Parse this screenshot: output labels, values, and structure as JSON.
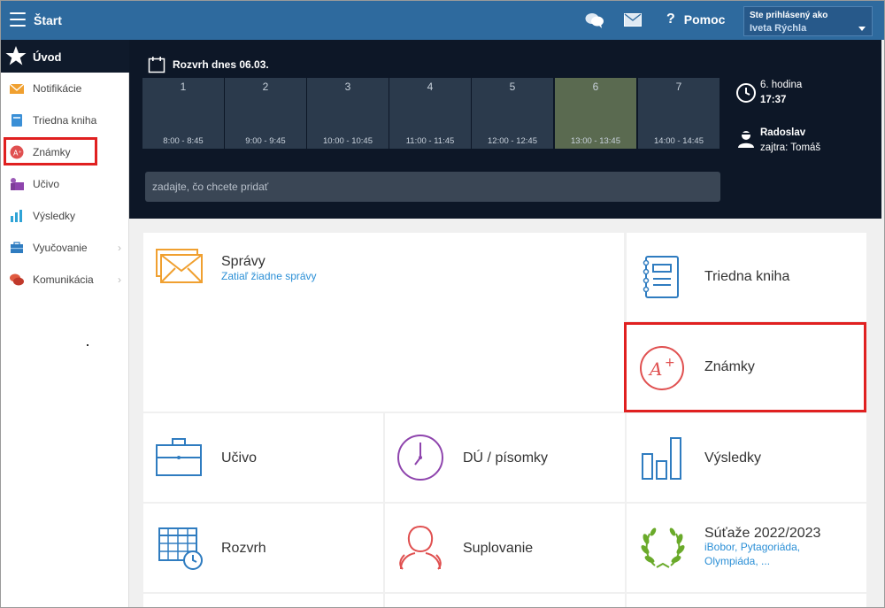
{
  "topbar": {
    "title": "Štart",
    "help_label": "Pomoc",
    "help_glyph": "?",
    "user_prefix": "Ste prihlásený ako",
    "user_name": "Iveta Rýchla"
  },
  "sidebar": {
    "header": "Úvod",
    "items": [
      {
        "label": "Notifikácie",
        "icon": "envelope-icon"
      },
      {
        "label": "Triedna kniha",
        "icon": "book-icon"
      },
      {
        "label": "Známky",
        "icon": "grade-icon"
      },
      {
        "label": "Učivo",
        "icon": "teacher-icon"
      },
      {
        "label": "Výsledky",
        "icon": "bar-chart-icon"
      },
      {
        "label": "Vyučovanie",
        "icon": "briefcase-icon",
        "chevron": "›"
      },
      {
        "label": "Komunikácia",
        "icon": "chat-icon",
        "chevron": "›"
      }
    ]
  },
  "schedule": {
    "title": "Rozvrh dnes 06.03.",
    "slots": [
      {
        "n": "1",
        "time": "8:00 - 8:45"
      },
      {
        "n": "2",
        "time": "9:00 - 9:45"
      },
      {
        "n": "3",
        "time": "10:00 - 10:45"
      },
      {
        "n": "4",
        "time": "11:00 - 11:45"
      },
      {
        "n": "5",
        "time": "12:00 - 12:45"
      },
      {
        "n": "6",
        "time": "13:00 - 13:45"
      },
      {
        "n": "7",
        "time": "14:00 - 14:45"
      }
    ],
    "current_slot": 6,
    "input_placeholder": "zadajte, čo chcete pridať",
    "hour_label": "6. hodina",
    "hour_time": "17:37",
    "person_name": "Radoslav",
    "person_tomorrow": "zajtra: Tomáš"
  },
  "tiles": {
    "spravy": {
      "label": "Správy",
      "sub": "Zatiaľ žiadne správy"
    },
    "triedna": {
      "label": "Triedna kniha"
    },
    "znamky": {
      "label": "Známky"
    },
    "ucivo": {
      "label": "Učivo"
    },
    "du": {
      "label": "DÚ / písomky"
    },
    "vysledky": {
      "label": "Výsledky"
    },
    "rozvrh": {
      "label": "Rozvrh"
    },
    "suplovanie": {
      "label": "Suplovanie"
    },
    "sutaze": {
      "label": "Súťaže 2022/2023",
      "sub1": "iBobor, Pytagoriáda,",
      "sub2": "Olympiáda, ..."
    }
  },
  "colors": {
    "topbar": "#2e6a9e",
    "panel": "#0d1727",
    "highlight": "#e02020",
    "link": "#2b8fd6",
    "orange": "#f0a030",
    "blue": "#2f7cc0",
    "red": "#e05050",
    "purple": "#8e44ad",
    "green": "#6aaa2a"
  }
}
